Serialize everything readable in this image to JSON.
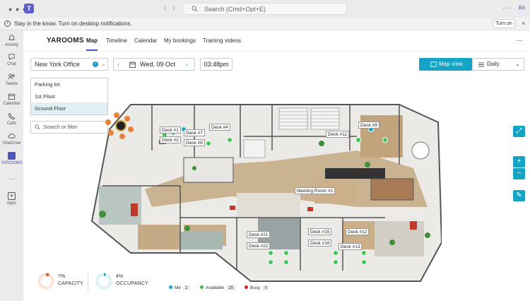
{
  "teams": {
    "search_placeholder": "Search (Cmd+Opt+E)",
    "avatar_initials": "EG",
    "more": "···"
  },
  "notification": {
    "text": "Stay in the know. Turn on desktop notifications.",
    "button": "Turn on",
    "close": "×"
  },
  "rail": {
    "items": [
      {
        "label": "Activity"
      },
      {
        "label": "Chat"
      },
      {
        "label": "Teams"
      },
      {
        "label": "Calendar"
      },
      {
        "label": "Calls"
      },
      {
        "label": "OneDrive"
      },
      {
        "label": "YAROOMS"
      },
      {
        "label": "Apps"
      }
    ],
    "more": "···"
  },
  "app": {
    "brand": "YAROOMS",
    "tabs": [
      "Map",
      "Timeline",
      "Calendar",
      "My bookings",
      "Training videos"
    ],
    "active_tab": "Map",
    "kebab": "···"
  },
  "controls": {
    "office": "New York Office",
    "date": "Wed, 09 Oct",
    "time": "03:48pm",
    "map_view": "Map view",
    "daily": "Daily",
    "prev": "‹",
    "next": "›"
  },
  "floors": [
    "Parking lot",
    "1st Floor",
    "Ground Floor"
  ],
  "selected_floor": "Ground Floor",
  "filter_placeholder": "Search or filter",
  "map_labels": {
    "desk1": "Desk #1",
    "desk2": "Desk #2",
    "desk7": "Desk #7",
    "desk8": "Desk #8",
    "desk4": "Desk #4",
    "desk11": "Desk #11",
    "desk9": "Desk #9",
    "meeting1": "Meeting Room #1",
    "desk21": "Desk #21",
    "desk22": "Desk #22",
    "desk15": "Desk #15",
    "desk16": "Desk #16",
    "desk12": "Desk #12",
    "desk13": "Desk #13"
  },
  "map_buttons": {
    "fullscreen": "⤢",
    "zoom_in": "+",
    "zoom_out": "−",
    "edit": "✎"
  },
  "stats": {
    "capacity_value": "7%",
    "capacity_label": "CAPACITY",
    "capacity_fraction": 0.07,
    "occupancy_value": "4%",
    "occupancy_label": "OCCUPANCY",
    "occupancy_fraction": 0.04,
    "legend": [
      {
        "label": "Me",
        "count": "2",
        "color": "#15a3c6"
      },
      {
        "label": "Available",
        "count": "25",
        "color": "#4caf50"
      },
      {
        "label": "Busy",
        "count": "0",
        "color": "#c62828"
      }
    ]
  },
  "colors": {
    "accent": "#15a3c6",
    "teams": "#4b53bc",
    "capacity_ring": "#e8572b",
    "occupancy_ring": "#15a3c6"
  }
}
